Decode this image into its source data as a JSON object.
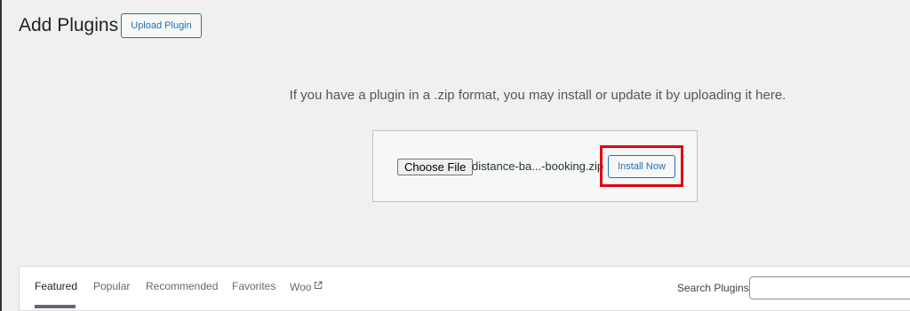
{
  "header": {
    "title": "Add Plugins",
    "upload_button_label": "Upload Plugin"
  },
  "upload": {
    "description": "If you have a plugin in a .zip format, you may install or update it by uploading it here.",
    "choose_file_label": "Choose File",
    "file_name": "distance-ba...-booking.zip",
    "install_button_label": "Install Now",
    "highlight_color": "#e00010"
  },
  "filters": {
    "tabs": [
      {
        "label": "Featured",
        "current": true
      },
      {
        "label": "Popular"
      },
      {
        "label": "Recommended"
      },
      {
        "label": "Favorites"
      },
      {
        "label": "Woo",
        "icon": "external-link-icon"
      }
    ],
    "search_label": "Search Plugins",
    "search_value": ""
  },
  "colors": {
    "accent": "#2271b1",
    "background": "#f0f0f1"
  }
}
